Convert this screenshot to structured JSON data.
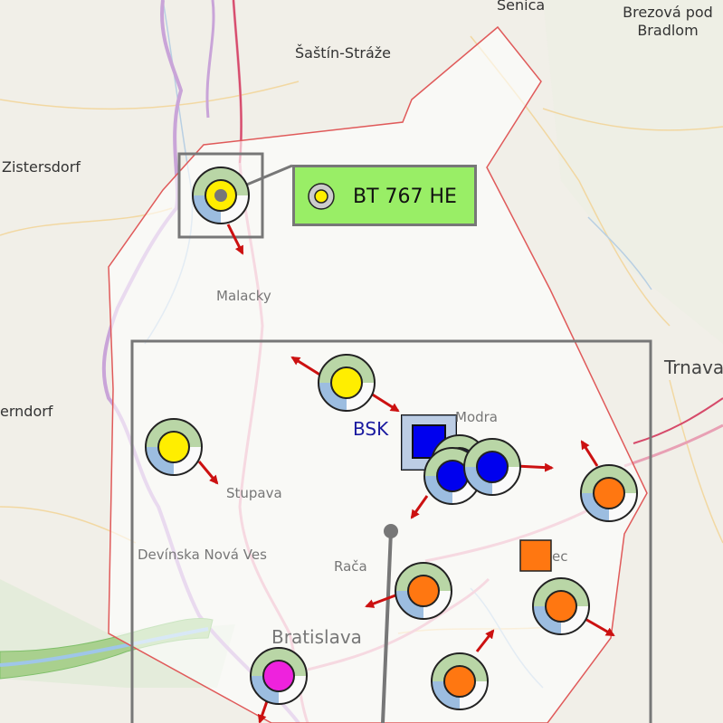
{
  "places": {
    "senica": "Senica",
    "brezova": "Brezová pod\nBradlom",
    "sastin": "Šaštín-Stráže",
    "zistersdorf": "Zistersdorf",
    "malacky": "Malacky",
    "trnava": "Trnava",
    "erndorf": "erndorf",
    "modra": "Modra",
    "stupava": "Stupava",
    "devinska": "Devínska Nová Ves",
    "raca": "Rača",
    "ec": "ec",
    "bratislava": "Bratislava"
  },
  "selected_label": {
    "callsign": "BT 767 HE"
  },
  "station": {
    "code": "BSK"
  },
  "colors": {
    "yellow": "#ffee00",
    "blue": "#0000ee",
    "orange": "#ff7711",
    "magenta": "#ee22dd",
    "label_bg": "#99ee66",
    "zone_border": "#e05a5a",
    "arrow": "#cc1111"
  }
}
